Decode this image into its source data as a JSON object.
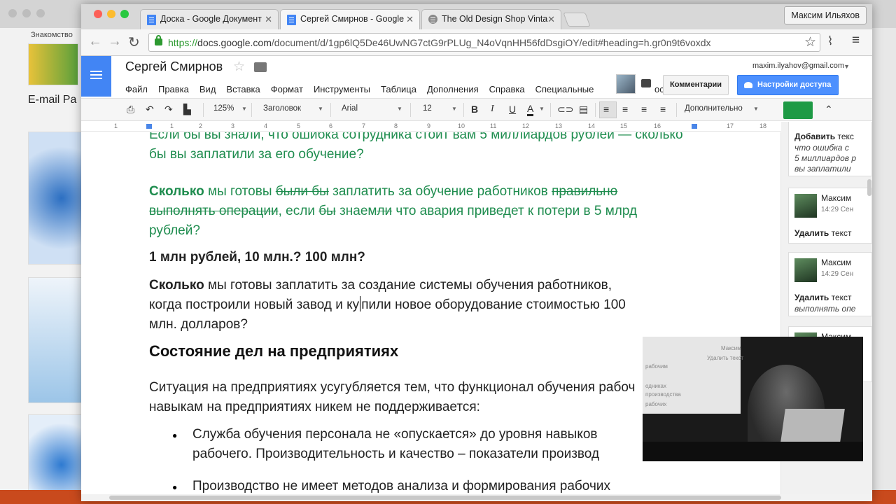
{
  "background_window": {
    "tab_label": "Знакомство",
    "caption": "E-mail Pa"
  },
  "tabs": [
    {
      "label": "Доска - Google Документ",
      "active": false
    },
    {
      "label": "Сергей Смирнов - Google",
      "active": true
    },
    {
      "label": "The Old Design Shop Vinta",
      "active": false
    }
  ],
  "user_button": "Максим Ильяхов",
  "address": {
    "scheme": "https://",
    "host": "docs.google.com",
    "path": "/document/d/1gp6lQ5De46UwNG7ctG9rPLUg_N4oVqnHH56fdDsgiOY/edit#heading=h.gr0n9t6voxdx"
  },
  "doc": {
    "title": "Сергей Смирнов",
    "account_email": "maxim.ilyahov@gmail.com",
    "menu": [
      "Файл",
      "Правка",
      "Вид",
      "Вставка",
      "Формат",
      "Инструменты",
      "Таблица",
      "Дополнения",
      "Справка",
      "Специальные"
    ],
    "menu_cut": "ос",
    "comments_button": "Комментарии",
    "share_button": "Настройки доступа"
  },
  "format_toolbar": {
    "zoom": "125%",
    "style": "Заголовок",
    "font": "Arial",
    "size": "12",
    "more": "Дополнительно"
  },
  "ruler_numbers": [
    "1",
    "1",
    "2",
    "3",
    "4",
    "5",
    "6",
    "7",
    "8",
    "9",
    "10",
    "11",
    "12",
    "13",
    "14",
    "15",
    "16",
    "17",
    "18"
  ],
  "content": {
    "p0_line1": "Если бы вы знали, что ошибка сотрудника стоит вам 5 миллиардов рублей — сколько",
    "p0_line2": "бы вы заплатили за его обучение?",
    "p1_bold": "Сколько",
    "p1_a": " мы готовы ",
    "p1_strike1": "были бы",
    "p1_b": " заплатить за обучение работников ",
    "p1_strike2": "правильно",
    "p1_strike3": "выполнять операции",
    "p1_c": ", если ",
    "p1_strike4": "бы",
    "p1_d": " знаем",
    "p1_strike5": "ли",
    "p1_e": " что авария приведет к потери в 5 млрд",
    "p1_f": "рублей?",
    "p2": "1 млн рублей, 10 млн.? 100 млн?",
    "p3_bold": "Сколько",
    "p3_line1": " мы готовы заплатить за создание системы обучения работников,",
    "p3_line2a": "когда построили новый завод и ку",
    "p3_line2b": "пили новое оборудование стоимостью 100",
    "p3_line3": "млн. долларов?",
    "heading": "Состояние дел на предприятиях",
    "p4_line1": "Ситуация на предприятиях  усугубляется тем, что функционал обучения рабоч",
    "p4_line2": "навыкам на предприятиях никем не поддерживается:",
    "b1_line1": "Служба обучения персонала не  «опускается» до уровня навыков",
    "b1_line2": "рабочего. Производительность и качество – показатели производ",
    "b2_line1": "Производство не имеет методов анализа и формирования рабочих"
  },
  "comments": [
    {
      "action": "Добавить",
      "action_cut": " текс",
      "lines": [
        "что ошибка с",
        "5 миллиардов р",
        "вы заплатили"
      ]
    },
    {
      "name": "Максим",
      "time": "14:29 Сен",
      "action": "Удалить",
      "action_cut": " текст",
      "lines": []
    },
    {
      "name": "Максим",
      "time": "14:29 Сен",
      "action": "Удалить",
      "action_cut": " текст",
      "lines": [
        "выполнять опе"
      ]
    },
    {
      "name": "Максим"
    }
  ],
  "webcam": {
    "labels": [
      "Максим",
      "Удалить текст",
      "рабочим",
      "одниках",
      "производства",
      "рабочих"
    ]
  }
}
